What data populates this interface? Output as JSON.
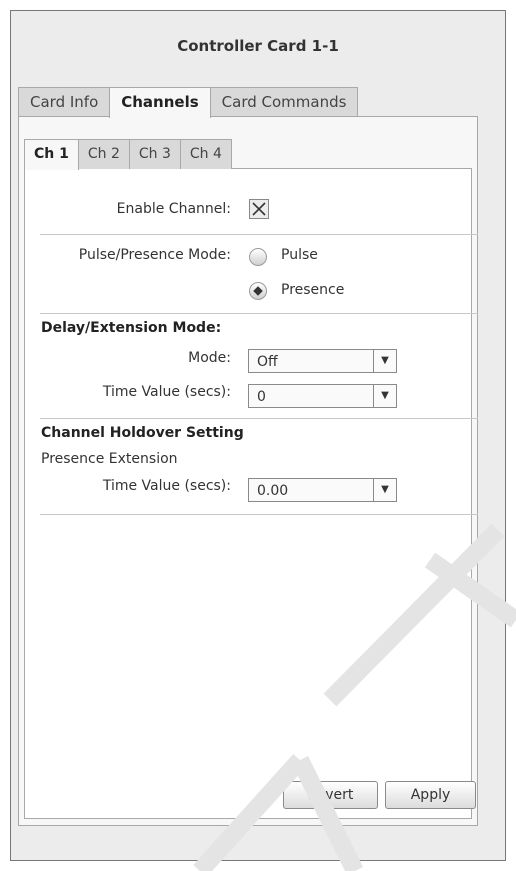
{
  "window": {
    "title": "Controller Card 1-1"
  },
  "outer_tabs": [
    {
      "label": "Card Info",
      "active": false
    },
    {
      "label": "Channels",
      "active": true
    },
    {
      "label": "Card Commands",
      "active": false
    }
  ],
  "inner_tabs": [
    {
      "label": "Ch 1",
      "active": true
    },
    {
      "label": "Ch 2",
      "active": false
    },
    {
      "label": "Ch 3",
      "active": false
    },
    {
      "label": "Ch 4",
      "active": false
    }
  ],
  "enable_channel": {
    "label": "Enable Channel:",
    "checked": true
  },
  "pulse_presence": {
    "label": "Pulse/Presence Mode:",
    "options": [
      {
        "label": "Pulse",
        "selected": false
      },
      {
        "label": "Presence",
        "selected": true
      }
    ]
  },
  "delay_extension": {
    "heading": "Delay/Extension Mode:",
    "mode_label": "Mode:",
    "mode_value": "Off",
    "time_label": "Time Value (secs):",
    "time_value": "0"
  },
  "holdover": {
    "heading": "Channel Holdover Setting",
    "subheading": "Presence Extension",
    "time_label": "Time Value (secs):",
    "time_value": "0.00"
  },
  "buttons": {
    "revert": "Revert",
    "apply": "Apply"
  }
}
